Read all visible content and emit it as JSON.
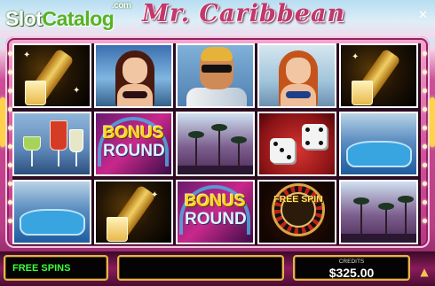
{
  "watermark": {
    "brand_part1": "Slot",
    "brand_part2": "Catalog",
    "domain_suffix": ".com"
  },
  "header": {
    "title": "Mr. Caribbean",
    "close_glyph": "✕"
  },
  "reels": {
    "symbols": [
      [
        "champagne",
        "brunette",
        "sunglasses-man",
        "redhead",
        "champagne"
      ],
      [
        "cocktails",
        "bonus-round",
        "palm-trees",
        "dice",
        "pool"
      ],
      [
        "pool",
        "champagne",
        "bonus-round",
        "free-spin-wheel",
        "palm-trees"
      ]
    ],
    "bonus_word": "BONUS",
    "round_word": "ROUND",
    "free_spin_text": "FREE SPIN"
  },
  "bottom_bar": {
    "free_spins_label": "FREE SPINS",
    "credits_label": "CREDITS",
    "credits_value": "$325.00"
  },
  "colors": {
    "frame_pink": "#d9559e",
    "free_spins_green": "#3cff3c",
    "bonus_gold": "#ffd21a",
    "panel_gold": "#e3b54c"
  }
}
